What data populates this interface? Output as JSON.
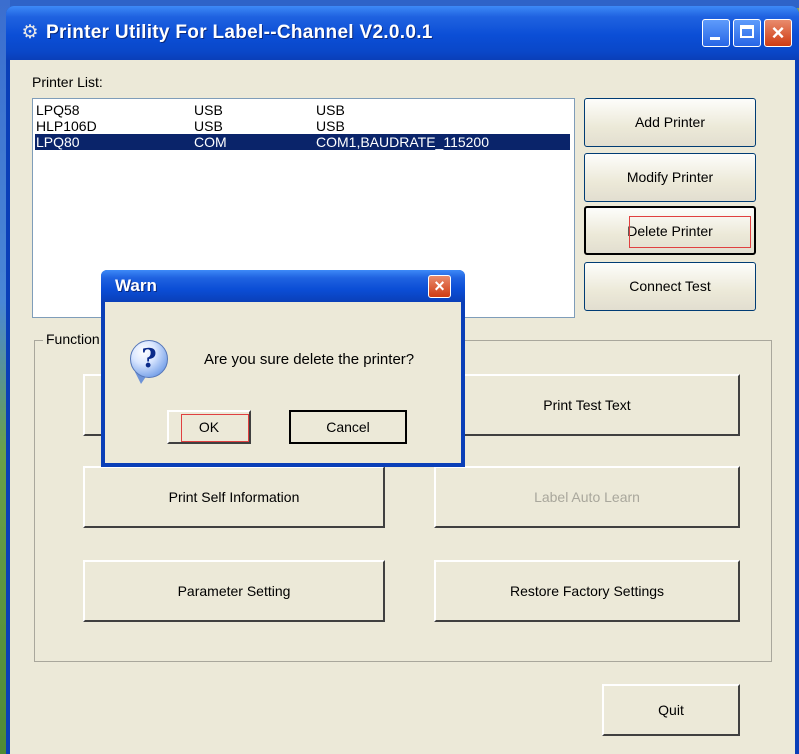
{
  "window": {
    "title": "Printer Utility For Label--Channel  V2.0.0.1",
    "icon": "gear-icon",
    "controls": {
      "minimize": "minimize-icon",
      "maximize": "maximize-icon",
      "close": "×"
    }
  },
  "printer_list": {
    "label": "Printer List:",
    "rows": [
      {
        "name": "LPQ58",
        "port": "USB",
        "detail": "USB"
      },
      {
        "name": "HLP106D",
        "port": "USB",
        "detail": "USB"
      },
      {
        "name": "LPQ80",
        "port": "COM",
        "detail": "COM1,BAUDRATE_115200"
      }
    ],
    "selected_index": 2
  },
  "side_buttons": {
    "add": "Add Printer",
    "modify": "Modify Printer",
    "delete": "Delete Printer",
    "connect": "Connect Test"
  },
  "function_group": {
    "label": "Function",
    "print_test_text": "Print Test Text",
    "print_self_info": "Print Self Information",
    "label_auto_learn": "Label Auto Learn",
    "parameter_setting": "Parameter Setting",
    "restore_factory": "Restore Factory Settings"
  },
  "quit_label": "Quit",
  "dialog": {
    "title": "Warn",
    "icon": "question-icon",
    "message": "Are you sure delete the printer?",
    "ok_label": "OK",
    "cancel_label": "Cancel",
    "close": "×"
  },
  "colors": {
    "titlebar": "#0a4ed6",
    "selection": "#0a246a",
    "window_bg": "#ece9d8",
    "focus_rect": "#e04040"
  }
}
